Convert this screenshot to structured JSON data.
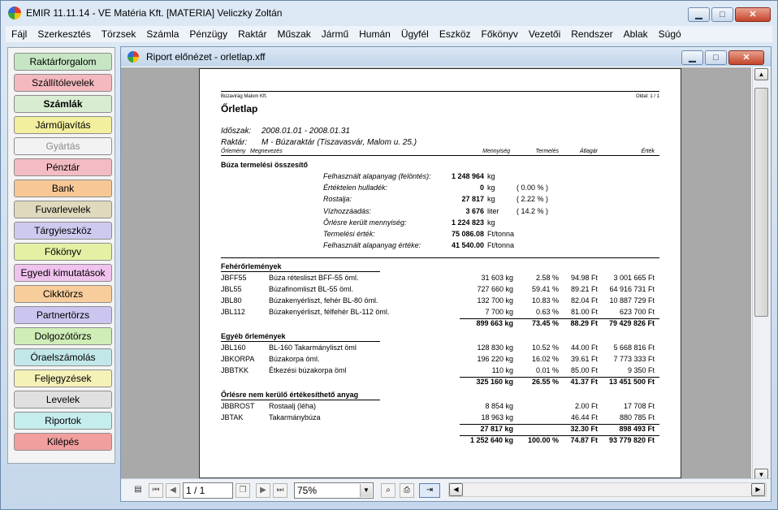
{
  "window": {
    "title": "EMIR 11.11.14 - VE Matéria Kft. [MATERIA] Veliczky Zoltán",
    "min": "▁",
    "max": "□",
    "close": "✕"
  },
  "menu": [
    "Fájl",
    "Szerkesztés",
    "Törzsek",
    "Számla",
    "Pénzügy",
    "Raktár",
    "Műszak",
    "Jármű",
    "Humán",
    "Ügyfél",
    "Eszköz",
    "Főkönyv",
    "Vezetői",
    "Rendszer",
    "Ablak",
    "Súgó"
  ],
  "sidebar": [
    {
      "label": "Raktárforgalom",
      "color": "#c6e6c3",
      "bold": false
    },
    {
      "label": "Szállítólevelek",
      "color": "#f3b9be",
      "bold": false
    },
    {
      "label": "Számlák",
      "color": "#d8ecd2",
      "bold": true
    },
    {
      "label": "Járműjavítás",
      "color": "#f2ef9e",
      "bold": false
    },
    {
      "label": "Gyártás",
      "color": "#f2f2f2",
      "bold": false,
      "disabled": true
    },
    {
      "label": "Pénztár",
      "color": "#f3bcc2",
      "bold": false
    },
    {
      "label": "Bank",
      "color": "#f7c795",
      "bold": false
    },
    {
      "label": "Fuvarlevelek",
      "color": "#dfd9bd",
      "bold": false
    },
    {
      "label": "Tárgyieszköz",
      "color": "#cdc9ef",
      "bold": false
    },
    {
      "label": "Főkönyv",
      "color": "#e5f0a4",
      "bold": false
    },
    {
      "label": "Egyedi kimutatások",
      "color": "#f0c2ee",
      "bold": false
    },
    {
      "label": "Cikktörzs",
      "color": "#f7cd9c",
      "bold": false
    },
    {
      "label": "Partnertörzs",
      "color": "#cbc6ef",
      "bold": false
    },
    {
      "label": "Dolgozótörzs",
      "color": "#cfedb6",
      "bold": false
    },
    {
      "label": "Óraelszámolás",
      "color": "#c2e7e9",
      "bold": false
    },
    {
      "label": "Feljegyzések",
      "color": "#f5f2b8",
      "bold": false
    },
    {
      "label": "Levelek",
      "color": "#e0e0e0",
      "bold": false
    },
    {
      "label": "Riportok",
      "color": "#c6eded",
      "bold": false
    },
    {
      "label": "Kilépés",
      "color": "#f19e9e",
      "bold": false
    }
  ],
  "preview": {
    "title": "Riport előnézet - orletlap.xff",
    "page_input": "1 / 1",
    "zoom": "75%"
  },
  "report": {
    "company": "Búzavirág Malom Kft.",
    "page": "Oldal: 1 / 1",
    "title": "Őrletlap",
    "period_label": "Időszak:",
    "period": "2008.01.01 - 2008.01.31",
    "warehouse_label": "Raktár:",
    "warehouse": "M - Búzaraktár (Tiszavasvár, Malom u. 25.)",
    "headers": {
      "code": "Őrlemény",
      "name": "Megnevezés",
      "qty": "Mennyiség",
      "yield": "Termelés",
      "price": "Átlagár",
      "value": "Érték"
    },
    "summary_title": "Búza termelési összesítő",
    "summary": [
      {
        "label": "Felhasznált alapanyag (felöntés):",
        "value": "1 248 964",
        "unit": "kg",
        "pct": ""
      },
      {
        "label": "Értéktelen hulladék:",
        "value": "0",
        "unit": "kg",
        "pct": "( 0.00 % )"
      },
      {
        "label": "Rostalja:",
        "value": "27 817",
        "unit": "kg",
        "pct": "( 2.22 % )"
      },
      {
        "label": "Vízhozzáadás:",
        "value": "3 676",
        "unit": "liter",
        "pct": "( 14.2 % )"
      },
      {
        "label": "Őrlésre került mennyiség:",
        "value": "1 224 823",
        "unit": "kg",
        "pct": ""
      },
      {
        "label": "Termelési érték:",
        "value": "75 086.08",
        "unit": "Ft/tonna",
        "pct": ""
      },
      {
        "label": "Felhasznált alapanyag értéke:",
        "value": "41 540.00",
        "unit": "Ft/tonna",
        "pct": ""
      }
    ],
    "groups": [
      {
        "title": "Fehérőrlemények",
        "rows": [
          {
            "code": "JBFF55",
            "name": "Búza rétesliszt BFF-55 öml.",
            "qty": "31 603 kg",
            "yield": "2.58 %",
            "price": "94.98 Ft",
            "value": "3 001 665 Ft"
          },
          {
            "code": "JBL55",
            "name": "Búzafinomliszt BL-55 öml.",
            "qty": "727 660 kg",
            "yield": "59.41 %",
            "price": "89.21 Ft",
            "value": "64 916 731 Ft"
          },
          {
            "code": "JBL80",
            "name": "Búzakenyérliszt, fehér BL-80 öml.",
            "qty": "132 700 kg",
            "yield": "10.83 %",
            "price": "82.04 Ft",
            "value": "10 887 729 Ft"
          },
          {
            "code": "JBL112",
            "name": "Búzakenyérliszt, félfehér BL-112 öml.",
            "qty": "7 700 kg",
            "yield": "0.63 %",
            "price": "81.00 Ft",
            "value": "623 700 Ft"
          }
        ],
        "total": {
          "qty": "899 663 kg",
          "yield": "73.45 %",
          "price": "88.29 Ft",
          "value": "79 429 826 Ft"
        }
      },
      {
        "title": "Egyéb őrlemények",
        "rows": [
          {
            "code": "JBL160",
            "name": "BL-160 Takarmányliszt öml",
            "qty": "128 830 kg",
            "yield": "10.52 %",
            "price": "44.00 Ft",
            "value": "5 668 816 Ft"
          },
          {
            "code": "JBKORPA",
            "name": "Búzakorpa öml.",
            "qty": "196 220 kg",
            "yield": "16.02 %",
            "price": "39.61 Ft",
            "value": "7 773 333 Ft"
          },
          {
            "code": "JBBTKK",
            "name": "Étkezési búzakorpa öml",
            "qty": "110 kg",
            "yield": "0.01 %",
            "price": "85.00 Ft",
            "value": "9 350 Ft"
          }
        ],
        "total": {
          "qty": "325 160 kg",
          "yield": "26.55 %",
          "price": "41.37 Ft",
          "value": "13 451 500 Ft"
        }
      },
      {
        "title": "Őrlésre nem kerülő értékesíthető anyag",
        "rows": [
          {
            "code": "JBBROST",
            "name": "Rostaalj (léha)",
            "qty": "8 854 kg",
            "yield": "",
            "price": "2.00 Ft",
            "value": "17 708 Ft"
          },
          {
            "code": "JBTAK",
            "name": "Takarmánybúza",
            "qty": "18 963 kg",
            "yield": "",
            "price": "46.44 Ft",
            "value": "880 785 Ft"
          }
        ],
        "total": {
          "qty": "27 817 kg",
          "yield": "",
          "price": "32.30 Ft",
          "value": "898 493 Ft"
        }
      }
    ],
    "grand_total": {
      "qty": "1 252 640 kg",
      "yield": "100.00 %",
      "price": "74.87 Ft",
      "value": "93 779 820 Ft"
    }
  }
}
